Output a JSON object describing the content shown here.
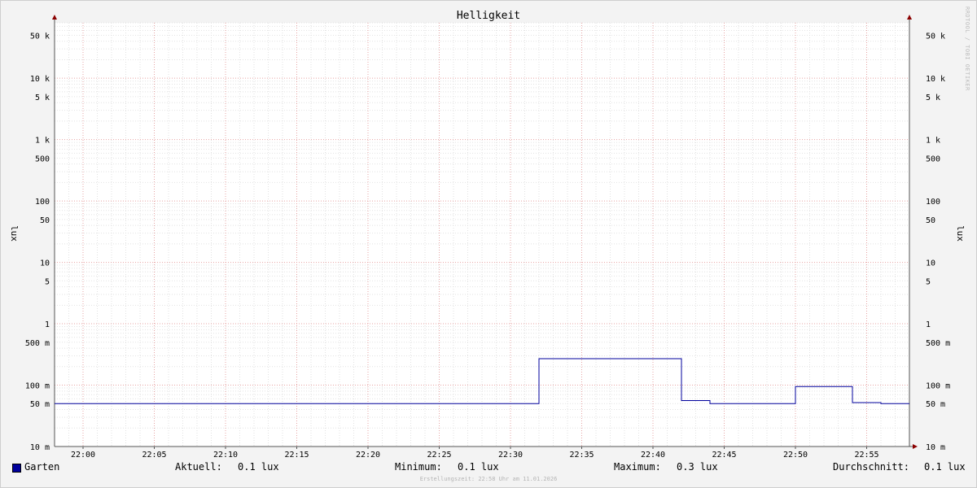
{
  "chart_data": {
    "type": "line",
    "title": "Helligkeit",
    "ylabel": "lux",
    "y_scale": "log",
    "ylim": [
      0.01,
      80000
    ],
    "y_ticks": [
      {
        "value": 50000,
        "label": "50 k"
      },
      {
        "value": 10000,
        "label": "10 k"
      },
      {
        "value": 5000,
        "label": "5 k"
      },
      {
        "value": 1000,
        "label": "1 k"
      },
      {
        "value": 500,
        "label": "500"
      },
      {
        "value": 100,
        "label": "100"
      },
      {
        "value": 50,
        "label": "50"
      },
      {
        "value": 10,
        "label": "10"
      },
      {
        "value": 5,
        "label": "5"
      },
      {
        "value": 1,
        "label": "1"
      },
      {
        "value": 0.5,
        "label": "500 m"
      },
      {
        "value": 0.1,
        "label": "100 m"
      },
      {
        "value": 0.05,
        "label": "50 m"
      },
      {
        "value": 0.01,
        "label": "10 m"
      }
    ],
    "x_ticks": [
      "22:00",
      "22:05",
      "22:10",
      "22:15",
      "22:20",
      "22:25",
      "22:30",
      "22:35",
      "22:40",
      "22:45",
      "22:50",
      "22:55"
    ],
    "xlim": [
      "21:58",
      "22:58"
    ],
    "grid": true,
    "series": [
      {
        "name": "Garten",
        "color": "#00009c",
        "points": [
          [
            "21:58",
            0.05
          ],
          [
            "22:32",
            0.05
          ],
          [
            "22:32",
            0.27
          ],
          [
            "22:42",
            0.27
          ],
          [
            "22:42",
            0.056
          ],
          [
            "22:44",
            0.056
          ],
          [
            "22:44",
            0.05
          ],
          [
            "22:50",
            0.05
          ],
          [
            "22:50",
            0.095
          ],
          [
            "22:54",
            0.095
          ],
          [
            "22:54",
            0.052
          ],
          [
            "22:56",
            0.052
          ],
          [
            "22:56",
            0.05
          ],
          [
            "22:58",
            0.05
          ]
        ]
      }
    ]
  },
  "legend": {
    "series_name": "Garten",
    "current_label": "Aktuell:",
    "current_value": "0.1 lux",
    "min_label": "Minimum:",
    "min_value": "0.1 lux",
    "max_label": "Maximum:",
    "max_value": "0.3 lux",
    "avg_label": "Durchschnitt:",
    "avg_value": "0.1 lux"
  },
  "footer": "Erstellungszeit: 22:58 Uhr am 11.01.2026",
  "watermark": "RRDTOOL / TOBI OETIKER"
}
